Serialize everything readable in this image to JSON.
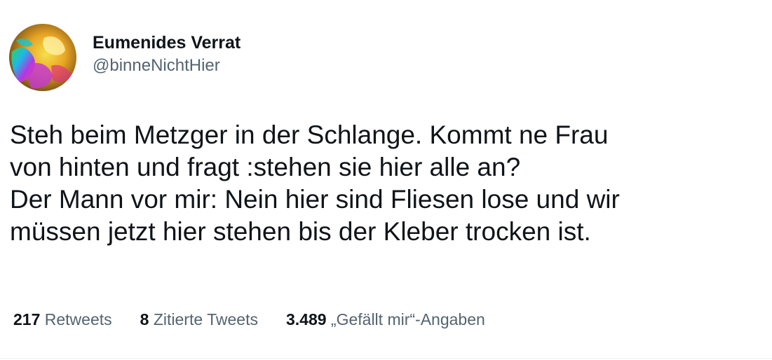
{
  "author": {
    "display_name": "Eumenides Verrat",
    "handle": "@binneNichtHier"
  },
  "tweet": {
    "lines": [
      "Steh beim Metzger in der Schlange. Kommt ne Frau",
      "von hinten und fragt :stehen sie hier alle an?",
      "Der Mann vor mir: Nein hier sind Fliesen lose und wir",
      "müssen jetzt hier stehen bis der Kleber trocken ist."
    ]
  },
  "stats": {
    "retweets": {
      "count": "217",
      "label": "Retweets"
    },
    "quotes": {
      "count": "8",
      "label": "Zitierte Tweets"
    },
    "likes": {
      "count": "3.489",
      "label": "„Gefällt mir“-Angaben"
    }
  },
  "colors": {
    "text_primary": "#0f1419",
    "text_secondary": "#536471"
  }
}
